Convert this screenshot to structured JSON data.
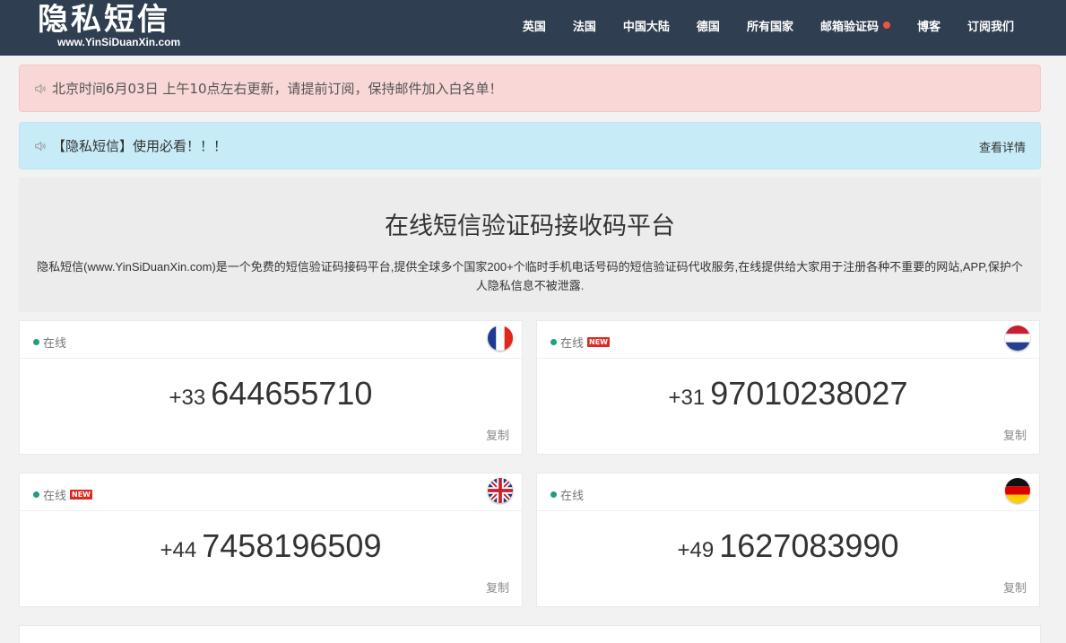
{
  "header": {
    "logo_main": "隐私短信",
    "logo_sub": "www.YinSiDuanXin.com",
    "nav": [
      {
        "label": "英国"
      },
      {
        "label": "法国"
      },
      {
        "label": "中国大陆"
      },
      {
        "label": "德国"
      },
      {
        "label": "所有国家"
      },
      {
        "label": "邮箱验证码"
      },
      {
        "label": "博客"
      },
      {
        "label": "订阅我们"
      }
    ]
  },
  "alerts": {
    "update_notice": "北京时间6月03日 上午10点左右更新，请提前订阅，保持邮件加入白名单！",
    "guide_notice": "【隐私短信】使用必看！！！",
    "guide_link": "查看详情"
  },
  "intro": {
    "title": "在线短信验证码接收码平台",
    "description": "隐私短信(www.YinSiDuanXin.com)是一个免费的短信验证码接码平台,提供全球多个国家200+个临时手机电话号码的短信验证码代收服务,在线提供给大家用于注册各种不重要的网站,APP,保护个人隐私信息不被泄露."
  },
  "cards": [
    {
      "status": "在线",
      "is_new": false,
      "country": "france",
      "prefix": "+33",
      "number": "644655710",
      "copy": "复制"
    },
    {
      "status": "在线",
      "is_new": true,
      "new_label": "NEW",
      "country": "netherlands",
      "prefix": "+31",
      "number": "97010238027",
      "copy": "复制"
    },
    {
      "status": "在线",
      "is_new": true,
      "new_label": "NEW",
      "country": "uk",
      "prefix": "+44",
      "number": "7458196509",
      "copy": "复制"
    },
    {
      "status": "在线",
      "is_new": false,
      "country": "germany",
      "prefix": "+49",
      "number": "1627083990",
      "copy": "复制"
    }
  ],
  "colors": {
    "header_bg": "#2f3e50",
    "online_dot": "#1e9e80",
    "new_badge": "#e0261e",
    "nav_dot": "#e8593c",
    "alert_pink": "#f8d7d6",
    "alert_blue": "#c7ebf7"
  },
  "icons": {
    "alert": "speaker-icon"
  }
}
